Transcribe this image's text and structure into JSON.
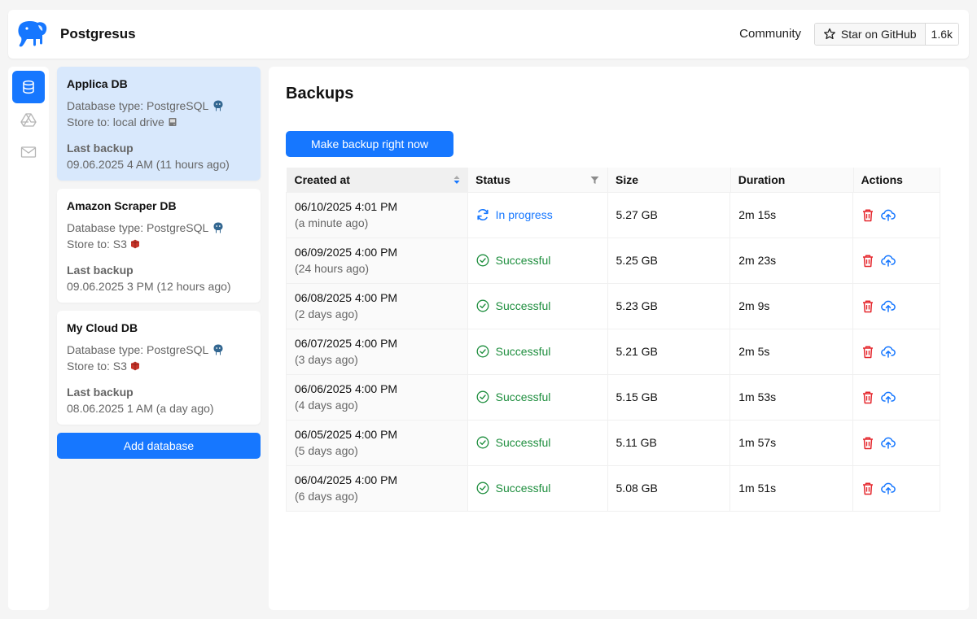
{
  "header": {
    "app_title": "Postgresus",
    "community_label": "Community",
    "github_star_label": "Star on GitHub",
    "github_star_count": "1.6k"
  },
  "rail": {
    "items": [
      {
        "icon": "database-icon",
        "active": true
      },
      {
        "icon": "drive-icon",
        "active": false
      },
      {
        "icon": "mail-icon",
        "active": false
      }
    ]
  },
  "databases": [
    {
      "name": "Applica DB",
      "type_text": "Database type: PostgreSQL",
      "store_text": "Store to: local drive",
      "store_icon": "hard-drive-icon",
      "last_backup_label": "Last backup",
      "last_backup_value": "09.06.2025 4 AM (11 hours ago)",
      "selected": true
    },
    {
      "name": "Amazon Scraper DB",
      "type_text": "Database type: PostgreSQL",
      "store_text": "Store to: S3",
      "store_icon": "s3-icon",
      "last_backup_label": "Last backup",
      "last_backup_value": "09.06.2025 3 PM (12 hours ago)",
      "selected": false
    },
    {
      "name": "My Cloud DB",
      "type_text": "Database type: PostgreSQL",
      "store_text": "Store to: S3",
      "store_icon": "s3-icon",
      "last_backup_label": "Last backup",
      "last_backup_value": "08.06.2025 1 AM (a day ago)",
      "selected": false
    }
  ],
  "add_database_label": "Add database",
  "main": {
    "title": "Backups",
    "backup_button_label": "Make backup right now",
    "columns": [
      "Created at",
      "Status",
      "Size",
      "Duration",
      "Actions"
    ],
    "rows": [
      {
        "date": "06/10/2025 4:01 PM",
        "ago": "(a minute ago)",
        "status": "In progress",
        "status_kind": "progress",
        "size": "5.27 GB",
        "duration": "2m 15s"
      },
      {
        "date": "06/09/2025 4:00 PM",
        "ago": "(24 hours ago)",
        "status": "Successful",
        "status_kind": "ok",
        "size": "5.25 GB",
        "duration": "2m 23s"
      },
      {
        "date": "06/08/2025 4:00 PM",
        "ago": "(2 days ago)",
        "status": "Successful",
        "status_kind": "ok",
        "size": "5.23 GB",
        "duration": "2m 9s"
      },
      {
        "date": "06/07/2025 4:00 PM",
        "ago": "(3 days ago)",
        "status": "Successful",
        "status_kind": "ok",
        "size": "5.21 GB",
        "duration": "2m 5s"
      },
      {
        "date": "06/06/2025 4:00 PM",
        "ago": "(4 days ago)",
        "status": "Successful",
        "status_kind": "ok",
        "size": "5.15 GB",
        "duration": "1m 53s"
      },
      {
        "date": "06/05/2025 4:00 PM",
        "ago": "(5 days ago)",
        "status": "Successful",
        "status_kind": "ok",
        "size": "5.11 GB",
        "duration": "1m 57s"
      },
      {
        "date": "06/04/2025 4:00 PM",
        "ago": "(6 days ago)",
        "status": "Successful",
        "status_kind": "ok",
        "size": "5.08 GB",
        "duration": "1m 51s"
      }
    ]
  },
  "colors": {
    "accent": "#1677ff",
    "success": "#1e8e3e",
    "danger": "#e5282e",
    "selected_card": "#d8e8fc"
  }
}
